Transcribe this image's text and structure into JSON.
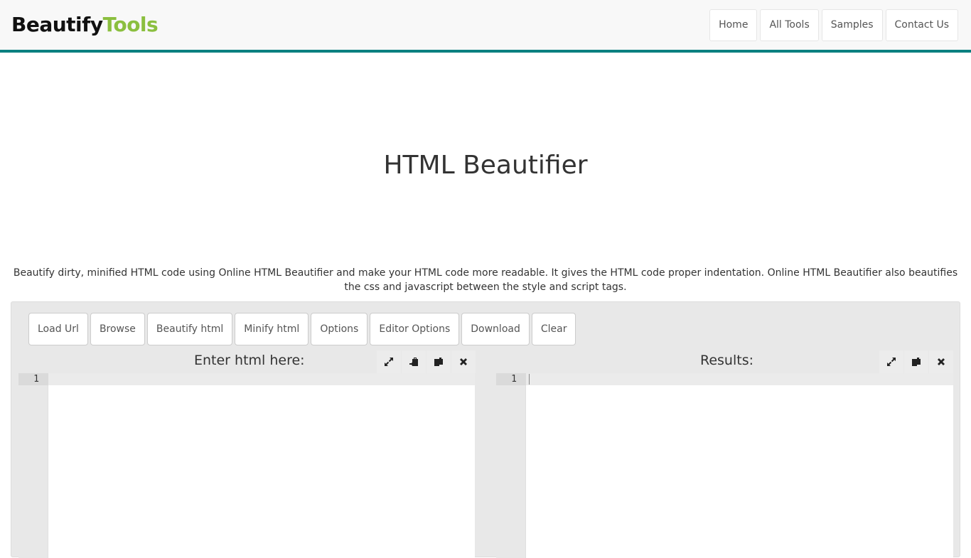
{
  "brand": {
    "part1": "Beautify",
    "part2": "Tools"
  },
  "nav": {
    "items": [
      {
        "label": "Home"
      },
      {
        "label": "All Tools"
      },
      {
        "label": "Samples"
      },
      {
        "label": "Contact Us"
      }
    ]
  },
  "page": {
    "title": "HTML Beautifier",
    "description": "Beautify dirty, minified HTML code using Online HTML Beautifier and make your HTML code more readable. It gives the HTML code proper indentation. Online HTML Beautifier also beautifies the css and javascript between the style and script tags."
  },
  "toolbar": {
    "buttons": [
      {
        "label": "Load Url"
      },
      {
        "label": "Browse"
      },
      {
        "label": "Beautify html"
      },
      {
        "label": "Minify html"
      },
      {
        "label": "Options"
      },
      {
        "label": "Editor Options"
      },
      {
        "label": "Download"
      },
      {
        "label": "Clear"
      }
    ]
  },
  "input_editor": {
    "label": "Enter html here:",
    "line_number": "1",
    "content": "",
    "icons": [
      "fullscreen-icon",
      "paste-icon",
      "copy-icon",
      "close-icon"
    ]
  },
  "output_editor": {
    "label": "Results:",
    "line_number": "1",
    "content": "",
    "icons": [
      "fullscreen-icon",
      "copy-icon",
      "close-icon"
    ]
  },
  "colors": {
    "accent": "#0a8080",
    "brand_green": "#8bbf3f",
    "brand_dark": "#111111"
  }
}
